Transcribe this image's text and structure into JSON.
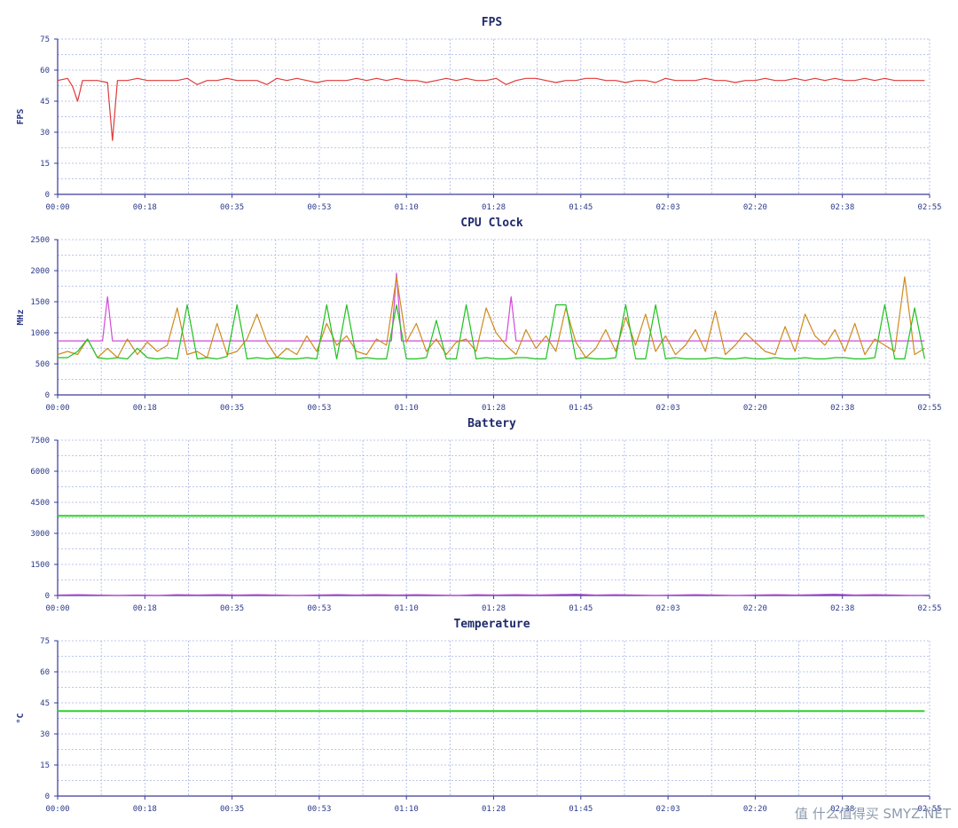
{
  "watermark": "值 什么值得买 SMYZ.NET",
  "colors": {
    "axis": "#3a3a9a",
    "grid": "#a8b4e6",
    "fps": "#e03a3a",
    "cpu_purple": "#d24ad8",
    "cpu_orange": "#d08a1c",
    "cpu_green": "#1fc11f",
    "battery_green": "#2fd02f",
    "battery_purple": "#b24cd0",
    "temp_green": "#2fd02f"
  },
  "chart_data": [
    {
      "type": "line",
      "title": "FPS",
      "ylabel": "FPS",
      "xlabel": "",
      "x_tick_labels": [
        "00:00",
        "00:18",
        "00:35",
        "00:53",
        "01:10",
        "01:28",
        "01:45",
        "02:03",
        "02:20",
        "02:38",
        "02:55"
      ],
      "xlim": [
        0,
        175
      ],
      "ylim": [
        0,
        75
      ],
      "y_ticks": [
        0,
        15,
        30,
        45,
        60,
        75
      ],
      "grid": true,
      "series": [
        {
          "color": "#e03a3a",
          "x": [
            0,
            2,
            3,
            4,
            5,
            6,
            8,
            10,
            11,
            12,
            14,
            16,
            18,
            20,
            22,
            24,
            26,
            28,
            30,
            32,
            34,
            36,
            38,
            40,
            42,
            44,
            46,
            48,
            50,
            52,
            54,
            56,
            58,
            60,
            62,
            64,
            66,
            68,
            70,
            72,
            74,
            76,
            78,
            80,
            82,
            84,
            86,
            88,
            90,
            92,
            94,
            96,
            98,
            100,
            102,
            104,
            106,
            108,
            110,
            112,
            114,
            116,
            118,
            120,
            122,
            124,
            126,
            128,
            130,
            132,
            134,
            136,
            138,
            140,
            142,
            144,
            146,
            148,
            150,
            152,
            154,
            156,
            158,
            160,
            162,
            164,
            166,
            168,
            170,
            172,
            174
          ],
          "y": [
            55,
            56,
            52,
            45,
            55,
            55,
            55,
            54,
            26,
            55,
            55,
            56,
            55,
            55,
            55,
            55,
            56,
            53,
            55,
            55,
            56,
            55,
            55,
            55,
            53,
            56,
            55,
            56,
            55,
            54,
            55,
            55,
            55,
            56,
            55,
            56,
            55,
            56,
            55,
            55,
            54,
            55,
            56,
            55,
            56,
            55,
            55,
            56,
            53,
            55,
            56,
            56,
            55,
            54,
            55,
            55,
            56,
            56,
            55,
            55,
            54,
            55,
            55,
            54,
            56,
            55,
            55,
            55,
            56,
            55,
            55,
            54,
            55,
            55,
            56,
            55,
            55,
            56,
            55,
            56,
            55,
            56,
            55,
            55,
            56,
            55,
            56,
            55,
            55,
            55,
            55
          ]
        }
      ]
    },
    {
      "type": "line",
      "title": "CPU Clock",
      "ylabel": "MHz",
      "xlabel": "",
      "x_tick_labels": [
        "00:00",
        "00:18",
        "00:35",
        "00:53",
        "01:10",
        "01:28",
        "01:45",
        "02:03",
        "02:20",
        "02:38",
        "02:55"
      ],
      "xlim": [
        0,
        175
      ],
      "ylim": [
        0,
        2500
      ],
      "y_ticks": [
        0,
        500,
        1000,
        1500,
        2000,
        2500
      ],
      "grid": true,
      "series": [
        {
          "color": "#d24ad8",
          "x": [
            0,
            9,
            10,
            11,
            12,
            67,
            68,
            69,
            70,
            90,
            91,
            92,
            93,
            174
          ],
          "y": [
            870,
            870,
            1580,
            870,
            870,
            870,
            1960,
            870,
            870,
            870,
            1580,
            870,
            870,
            870
          ]
        },
        {
          "color": "#d08a1c",
          "x": [
            0,
            2,
            4,
            6,
            8,
            10,
            12,
            14,
            16,
            18,
            20,
            22,
            24,
            26,
            28,
            30,
            32,
            34,
            36,
            38,
            40,
            42,
            44,
            46,
            48,
            50,
            52,
            54,
            56,
            58,
            60,
            62,
            64,
            66,
            68,
            70,
            72,
            74,
            76,
            78,
            80,
            82,
            84,
            86,
            88,
            90,
            92,
            94,
            96,
            98,
            100,
            102,
            104,
            106,
            108,
            110,
            112,
            114,
            116,
            118,
            120,
            122,
            124,
            126,
            128,
            130,
            132,
            134,
            136,
            138,
            140,
            142,
            144,
            146,
            148,
            150,
            152,
            154,
            156,
            158,
            160,
            162,
            164,
            166,
            168,
            170,
            172,
            174
          ],
          "y": [
            650,
            700,
            650,
            900,
            600,
            750,
            600,
            900,
            650,
            850,
            700,
            800,
            1400,
            650,
            700,
            600,
            1150,
            650,
            700,
            900,
            1300,
            850,
            600,
            750,
            650,
            950,
            700,
            1150,
            800,
            950,
            700,
            650,
            900,
            800,
            1900,
            850,
            1150,
            700,
            900,
            650,
            850,
            900,
            700,
            1400,
            1000,
            800,
            650,
            1050,
            750,
            950,
            700,
            1400,
            850,
            600,
            750,
            1050,
            700,
            1250,
            800,
            1300,
            700,
            950,
            650,
            800,
            1050,
            700,
            1350,
            650,
            800,
            1000,
            850,
            700,
            650,
            1100,
            700,
            1300,
            950,
            800,
            1050,
            700,
            1150,
            650,
            900,
            800,
            700,
            1900,
            650,
            750
          ]
        },
        {
          "color": "#1fc11f",
          "x": [
            0,
            2,
            4,
            6,
            8,
            10,
            12,
            14,
            16,
            18,
            20,
            22,
            24,
            26,
            28,
            30,
            32,
            34,
            36,
            38,
            40,
            42,
            44,
            46,
            48,
            50,
            52,
            54,
            56,
            58,
            60,
            62,
            64,
            66,
            68,
            70,
            72,
            74,
            76,
            78,
            80,
            82,
            84,
            86,
            88,
            90,
            92,
            94,
            96,
            98,
            100,
            102,
            104,
            106,
            108,
            110,
            112,
            114,
            116,
            118,
            120,
            122,
            124,
            126,
            128,
            130,
            132,
            134,
            136,
            138,
            140,
            142,
            144,
            146,
            148,
            150,
            152,
            154,
            156,
            158,
            160,
            162,
            164,
            166,
            168,
            170,
            172,
            174
          ],
          "y": [
            600,
            600,
            700,
            900,
            600,
            580,
            600,
            580,
            750,
            600,
            580,
            600,
            580,
            1450,
            580,
            600,
            580,
            620,
            1450,
            580,
            600,
            580,
            600,
            580,
            580,
            600,
            580,
            1450,
            580,
            1450,
            580,
            600,
            580,
            580,
            1450,
            580,
            580,
            600,
            1200,
            580,
            580,
            1450,
            580,
            600,
            580,
            580,
            600,
            600,
            580,
            580,
            1450,
            1450,
            580,
            600,
            580,
            580,
            600,
            1450,
            580,
            580,
            1450,
            580,
            600,
            580,
            580,
            580,
            600,
            580,
            580,
            600,
            580,
            580,
            600,
            580,
            580,
            600,
            580,
            580,
            600,
            600,
            580,
            580,
            600,
            1450,
            580,
            580,
            1400,
            580
          ]
        }
      ]
    },
    {
      "type": "line",
      "title": "Battery",
      "ylabel": "",
      "xlabel": "",
      "x_tick_labels": [
        "00:00",
        "00:18",
        "00:35",
        "00:53",
        "01:10",
        "01:28",
        "01:45",
        "02:03",
        "02:20",
        "02:38",
        "02:55"
      ],
      "xlim": [
        0,
        175
      ],
      "ylim": [
        0,
        7500
      ],
      "y_ticks": [
        0,
        1500,
        3000,
        4500,
        6000,
        7500
      ],
      "grid": true,
      "series": [
        {
          "color": "#2fd02f",
          "x": [
            0,
            174
          ],
          "y": [
            3850,
            3850
          ]
        },
        {
          "color": "#b24cd0",
          "x": [
            0,
            4,
            8,
            12,
            16,
            20,
            24,
            28,
            32,
            36,
            40,
            44,
            48,
            52,
            56,
            60,
            64,
            68,
            72,
            76,
            80,
            84,
            88,
            92,
            96,
            100,
            104,
            108,
            112,
            116,
            120,
            124,
            128,
            132,
            136,
            140,
            144,
            148,
            152,
            156,
            160,
            164,
            168,
            172,
            174
          ],
          "y": [
            20,
            40,
            20,
            0,
            20,
            0,
            40,
            20,
            40,
            20,
            40,
            20,
            0,
            20,
            40,
            20,
            40,
            20,
            40,
            20,
            0,
            40,
            20,
            40,
            20,
            40,
            60,
            20,
            40,
            20,
            0,
            20,
            40,
            20,
            0,
            20,
            40,
            20,
            40,
            60,
            20,
            40,
            20,
            0,
            10
          ]
        }
      ]
    },
    {
      "type": "line",
      "title": "Temperature",
      "ylabel": "°C",
      "xlabel": "",
      "x_tick_labels": [
        "00:00",
        "00:18",
        "00:35",
        "00:53",
        "01:10",
        "01:28",
        "01:45",
        "02:03",
        "02:20",
        "02:38",
        "02:55"
      ],
      "xlim": [
        0,
        175
      ],
      "ylim": [
        0,
        75
      ],
      "y_ticks": [
        0,
        15,
        30,
        45,
        60,
        75
      ],
      "grid": true,
      "series": [
        {
          "color": "#2fd02f",
          "x": [
            0,
            174
          ],
          "y": [
            41,
            41
          ]
        }
      ]
    }
  ]
}
